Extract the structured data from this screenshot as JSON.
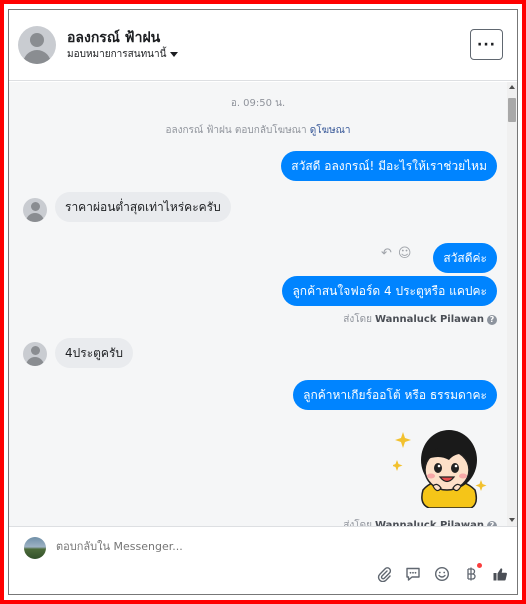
{
  "header": {
    "contact_name": "อลงกรณ์ ฟ้าฝน",
    "assign_label": "มอบหมายการสนทนานี้",
    "more_label": "···"
  },
  "conversation": {
    "timestamp": "อ. 09:50 น.",
    "reply_note_prefix": "อลงกรณ์ ฟ้าฝน ตอบกลับโฆษณา",
    "reply_note_link": "ดูโฆษณา",
    "messages": [
      {
        "from": "page",
        "text": "สวัสดี อลงกรณ์! มีอะไรให้เราช่วยไหม"
      },
      {
        "from": "user",
        "text": "ราคาผ่อนต่ำสุดเท่าไหร่คะครับ"
      },
      {
        "from": "page",
        "text": "สวัสดีค่ะ"
      },
      {
        "from": "page",
        "text": "ลูกค้าสนใจฟอร์ด 4 ประตูหรือ แคปคะ"
      },
      {
        "from": "user",
        "text": "4ประตูครับ"
      },
      {
        "from": "page",
        "text": "ลูกค้าหาเกียร์ออโต้  หรือ  ธรรมดาคะ"
      }
    ],
    "sent_by_prefix": "ส่งโดย",
    "sent_by_name": "Wannaluck Pilawan",
    "help_glyph": "?",
    "reply_icon": "↶",
    "react_icon": "☺"
  },
  "composer": {
    "placeholder": "ตอบกลับใน Messenger..."
  },
  "colors": {
    "outgoing_bubble": "#0084ff",
    "incoming_bubble": "#e9ebee",
    "frame_border": "#ff0000"
  }
}
